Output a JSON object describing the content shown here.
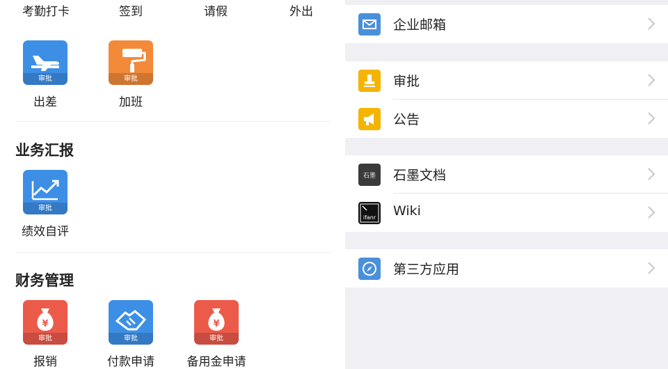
{
  "left": {
    "top_row": [
      "考勤打卡",
      "签到",
      "请假",
      "外出"
    ],
    "attendance_apps": [
      {
        "label": "出差",
        "badge": "审批",
        "icon": "airplane-icon",
        "color": "#3d8fe6"
      },
      {
        "label": "加班",
        "badge": "审批",
        "icon": "paint-roller-icon",
        "color": "#f28a3a"
      }
    ],
    "business_report": {
      "title": "业务汇报",
      "apps": [
        {
          "label": "绩效自评",
          "badge": "审批",
          "icon": "growth-chart-icon",
          "color": "#3d8fe6"
        }
      ]
    },
    "finance": {
      "title": "财务管理",
      "apps": [
        {
          "label": "报销",
          "badge": "审批",
          "icon": "money-bag-icon",
          "color": "#ec5a4a"
        },
        {
          "label": "付款申请",
          "badge": "审批",
          "icon": "handshake-icon",
          "color": "#3d8fe6"
        },
        {
          "label": "备用金申请",
          "badge": "审批",
          "icon": "money-bag-icon",
          "color": "#ec5a4a"
        }
      ]
    }
  },
  "right": {
    "groups": [
      [
        {
          "label": "企业邮箱",
          "icon": "mail-icon",
          "color": "#4a90d9"
        }
      ],
      [
        {
          "label": "审批",
          "icon": "stamp-icon",
          "color": "#f5b400"
        },
        {
          "label": "公告",
          "icon": "megaphone-icon",
          "color": "#f5b400"
        }
      ],
      [
        {
          "label": "石墨文档",
          "icon": "shimo-icon",
          "icon_text": "石墨",
          "color": "#3a3a3a"
        },
        {
          "label": "Wiki",
          "icon": "ifanr-icon",
          "icon_text": "ifanr",
          "color": "#111111"
        }
      ],
      [
        {
          "label": "第三方应用",
          "icon": "compass-icon",
          "color": "#4a90d9"
        }
      ]
    ]
  }
}
